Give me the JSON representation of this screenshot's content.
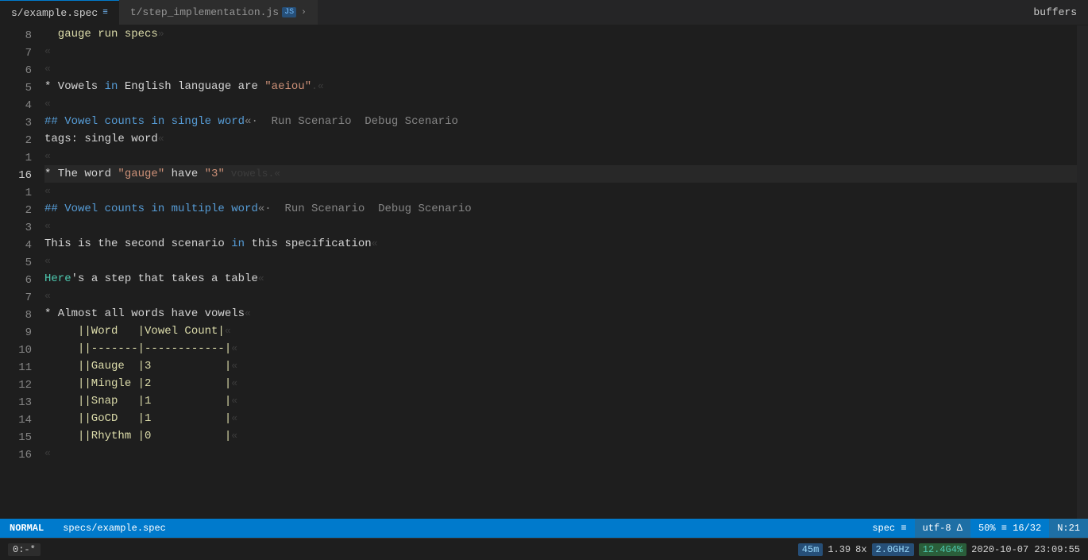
{
  "tabs": {
    "active": {
      "name": "s/example.spec",
      "label": "s/example.spec",
      "icon": "≡",
      "iconColor": "#d4d4d4"
    },
    "inactive": {
      "name": "t/step_implementation.js",
      "label": "t/step_implementation.js",
      "icon": "JS",
      "iconColor": "#75beff"
    },
    "right_label": "buffers"
  },
  "lines": [
    {
      "num": "8",
      "active": false,
      "content": [
        {
          "text": "  gauge run specs",
          "cls": "c-yellow"
        },
        {
          "text": "»",
          "cls": "pilcrow"
        }
      ]
    },
    {
      "num": "7",
      "active": false,
      "content": [
        {
          "text": "«",
          "cls": "pilcrow"
        }
      ]
    },
    {
      "num": "6",
      "active": false,
      "content": [
        {
          "text": "«",
          "cls": "pilcrow"
        }
      ]
    },
    {
      "num": "5",
      "active": false,
      "content": [
        {
          "text": "* Vowels ",
          "cls": "c-white"
        },
        {
          "text": "in",
          "cls": "c-keyword"
        },
        {
          "text": " English language are ",
          "cls": "c-white"
        },
        {
          "text": "\"aeiou\"",
          "cls": "c-str"
        },
        {
          "text": ".«",
          "cls": "pilcrow"
        }
      ]
    },
    {
      "num": "4",
      "active": false,
      "content": [
        {
          "text": "«",
          "cls": "pilcrow"
        }
      ]
    },
    {
      "num": "3",
      "active": false,
      "content": [
        {
          "text": "## Vowel counts in single word",
          "cls": "c-heading"
        },
        {
          "text": "«·  Run Scenario  Debug Scenario",
          "cls": "c-muted"
        }
      ]
    },
    {
      "num": "2",
      "active": false,
      "content": [
        {
          "text": "tags",
          "cls": "c-white"
        },
        {
          "text": ": single word",
          "cls": "c-white"
        },
        {
          "text": "«",
          "cls": "pilcrow"
        }
      ]
    },
    {
      "num": "1",
      "active": false,
      "content": [
        {
          "text": "«",
          "cls": "pilcrow"
        }
      ]
    },
    {
      "num": "16",
      "active": true,
      "content": [
        {
          "text": "* The word ",
          "cls": "c-white"
        },
        {
          "text": "\"gauge\"",
          "cls": "c-str"
        },
        {
          "text": " have ",
          "cls": "c-white"
        },
        {
          "text": "\"3\"",
          "cls": "c-str"
        },
        {
          "text": " vowels.«",
          "cls": "pilcrow"
        }
      ]
    },
    {
      "num": "1",
      "active": false,
      "content": [
        {
          "text": "«",
          "cls": "pilcrow"
        }
      ]
    },
    {
      "num": "2",
      "active": false,
      "content": [
        {
          "text": "## Vowel counts in multiple word",
          "cls": "c-heading"
        },
        {
          "text": "«·  Run Scenario  Debug Scenario",
          "cls": "c-muted"
        }
      ]
    },
    {
      "num": "3",
      "active": false,
      "content": [
        {
          "text": "«",
          "cls": "pilcrow"
        }
      ]
    },
    {
      "num": "4",
      "active": false,
      "content": [
        {
          "text": "This is the second scenario ",
          "cls": "c-white"
        },
        {
          "text": "in",
          "cls": "c-keyword"
        },
        {
          "text": " this specification",
          "cls": "c-white"
        },
        {
          "text": "«",
          "cls": "pilcrow"
        }
      ]
    },
    {
      "num": "5",
      "active": false,
      "content": [
        {
          "text": "«",
          "cls": "pilcrow"
        }
      ]
    },
    {
      "num": "6",
      "active": false,
      "content": [
        {
          "text": "Here",
          "cls": "c-tag"
        },
        {
          "text": "'s a step that takes a table",
          "cls": "c-white"
        },
        {
          "text": "«",
          "cls": "pilcrow"
        }
      ]
    },
    {
      "num": "7",
      "active": false,
      "content": [
        {
          "text": "«",
          "cls": "pilcrow"
        }
      ]
    },
    {
      "num": "8",
      "active": false,
      "content": [
        {
          "text": "* Almost all words have vowels",
          "cls": "c-white"
        },
        {
          "text": "«",
          "cls": "pilcrow"
        }
      ]
    },
    {
      "num": "9",
      "active": false,
      "content": [
        {
          "text": "     ||Word   |Vowel Count|",
          "cls": "c-yellow"
        },
        {
          "text": "«",
          "cls": "pilcrow"
        }
      ]
    },
    {
      "num": "10",
      "active": false,
      "content": [
        {
          "text": "     ||-------|------------|",
          "cls": "c-yellow"
        },
        {
          "text": "«",
          "cls": "pilcrow"
        }
      ]
    },
    {
      "num": "11",
      "active": false,
      "content": [
        {
          "text": "     ||Gauge  |3           |",
          "cls": "c-yellow"
        },
        {
          "text": "«",
          "cls": "pilcrow"
        }
      ]
    },
    {
      "num": "12",
      "active": false,
      "content": [
        {
          "text": "     ||Mingle |2           |",
          "cls": "c-yellow"
        },
        {
          "text": "«",
          "cls": "pilcrow"
        }
      ]
    },
    {
      "num": "13",
      "active": false,
      "content": [
        {
          "text": "     ||Snap   |1           |",
          "cls": "c-yellow"
        },
        {
          "text": "«",
          "cls": "pilcrow"
        }
      ]
    },
    {
      "num": "14",
      "active": false,
      "content": [
        {
          "text": "     ||GoCD   |1           |",
          "cls": "c-yellow"
        },
        {
          "text": "«",
          "cls": "pilcrow"
        }
      ]
    },
    {
      "num": "15",
      "active": false,
      "content": [
        {
          "text": "     ||Rhythm |0           |",
          "cls": "c-yellow"
        },
        {
          "text": "«",
          "cls": "pilcrow"
        }
      ]
    },
    {
      "num": "16",
      "active": false,
      "content": [
        {
          "text": "«",
          "cls": "pilcrow"
        }
      ]
    }
  ],
  "status": {
    "mode": "NORMAL",
    "path": "specs/example.spec",
    "filetype": "spec ≡",
    "encoding": "utf-8 ∆",
    "position": "50% ≡ 16/32",
    "col": "N:21"
  },
  "terminal": {
    "badge": "0:-*",
    "mem": "45m",
    "load": "1.39",
    "cpu_cores": "8x",
    "cpu_freq": "2.0GHz",
    "disk": "12.4G4%",
    "datetime": "2020-10-07 23:09:55"
  }
}
